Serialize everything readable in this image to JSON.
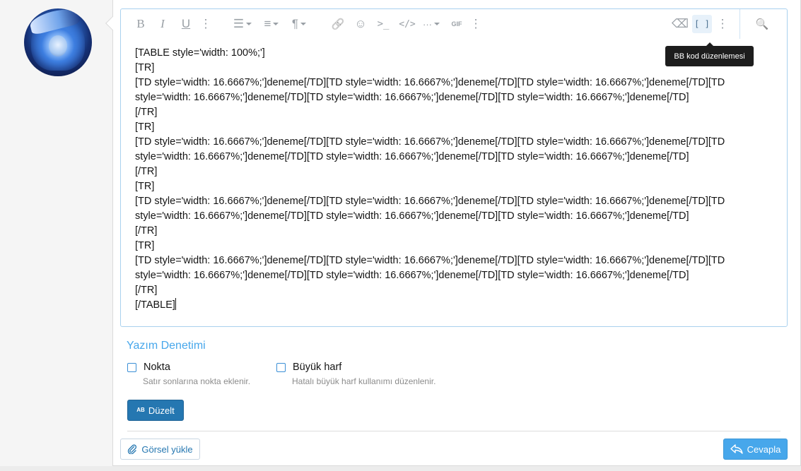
{
  "toolbar": {
    "bold": "B",
    "italic": "I",
    "underline": "U",
    "more1": "⋮",
    "list": "☰",
    "align": "≡",
    "paragraph": "¶",
    "link": "🔗",
    "smilie": "☺",
    "code_inline": ">_",
    "code": "</>",
    "insert": "···",
    "gif": "GIF",
    "more2": "⋮",
    "eraser": "⌫",
    "bbcode": "[ ]",
    "more3": "⋮",
    "preview": "🔍",
    "tooltip": "BB kod düzenlemesi"
  },
  "editor": {
    "lines": [
      "[TABLE style='width: 100%;']",
      "[TR]",
      "[TD style='width: 16.6667%;']deneme[/TD][TD style='width: 16.6667%;']deneme[/TD][TD style='width: 16.6667%;']deneme[/TD][TD",
      "style='width: 16.6667%;']deneme[/TD][TD style='width: 16.6667%;']deneme[/TD][TD style='width: 16.6667%;']deneme[/TD]",
      "[/TR]",
      "[TR]",
      "[TD style='width: 16.6667%;']deneme[/TD][TD style='width: 16.6667%;']deneme[/TD][TD style='width: 16.6667%;']deneme[/TD][TD",
      "style='width: 16.6667%;']deneme[/TD][TD style='width: 16.6667%;']deneme[/TD][TD style='width: 16.6667%;']deneme[/TD]",
      "[/TR]",
      "[TR]",
      "[TD style='width: 16.6667%;']deneme[/TD][TD style='width: 16.6667%;']deneme[/TD][TD style='width: 16.6667%;']deneme[/TD][TD",
      "style='width: 16.6667%;']deneme[/TD][TD style='width: 16.6667%;']deneme[/TD][TD style='width: 16.6667%;']deneme[/TD]",
      "[/TR]",
      "[TR]",
      "[TD style='width: 16.6667%;']deneme[/TD][TD style='width: 16.6667%;']deneme[/TD][TD style='width: 16.6667%;']deneme[/TD][TD",
      "style='width: 16.6667%;']deneme[/TD][TD style='width: 16.6667%;']deneme[/TD][TD style='width: 16.6667%;']deneme[/TD]",
      "[/TR]",
      "[/TABLE]"
    ]
  },
  "spellcheck": {
    "title": "Yazım Denetimi",
    "options": [
      {
        "label": "Nokta",
        "hint": "Satır sonlarına nokta eklenir.",
        "checked": false
      },
      {
        "label": "Büyük harf",
        "hint": "Hatalı büyük harf kullanımı düzenlenir.",
        "checked": false
      }
    ],
    "fix_button": "Düzelt",
    "fix_icon": "AB"
  },
  "actions": {
    "upload_label": "Görsel yükle",
    "reply_label": "Cevapla"
  },
  "colors": {
    "accent": "#47a7eb",
    "button_primary": "#2577b1",
    "editor_border": "#a9d1ee"
  }
}
